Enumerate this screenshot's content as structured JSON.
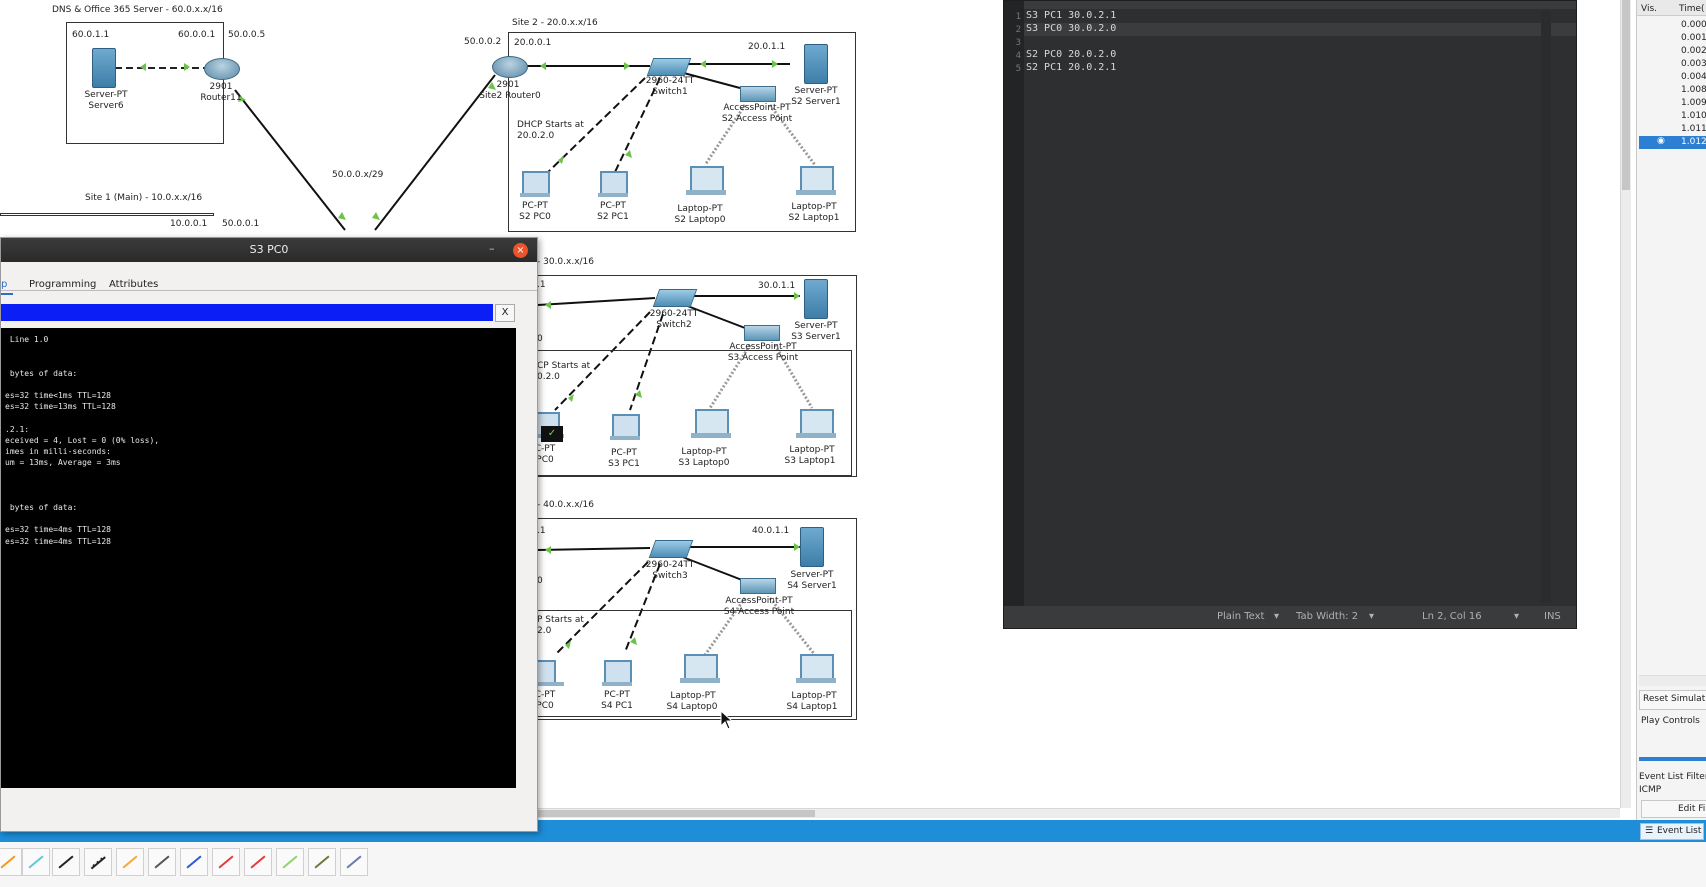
{
  "topology": {
    "dns_box": {
      "title": "DNS & Office 365 Server - 60.0.x.x/16",
      "ip_left": "60.0.1.1",
      "ip_right": "60.0.0.1",
      "ip_link": "50.0.0.5",
      "server_type": "Server-PT",
      "server_name": "Server6",
      "router_model": "2901",
      "router_name": "Router11"
    },
    "site1": {
      "title": "Site 1 (Main) - 10.0.x.x/16",
      "ip_a": "10.0.0.1",
      "ip_b": "50.0.0.1",
      "wan": "50.0.0.x/29"
    },
    "site2": {
      "title": "Site 2 - 20.0.x.x/16",
      "router_ip_wan": "50.0.0.2",
      "router_ip_lan": "20.0.0.1",
      "router_model": "2901",
      "router_name": "Site2 Router0",
      "switch_model": "2960-24TT",
      "switch_name": "Switch1",
      "server_ip": "20.0.1.1",
      "server_type": "Server-PT",
      "server_name": "S2 Server1",
      "ap_type": "AccessPoint-PT",
      "ap_name": "S2 Access Point",
      "dhcp_note_1": "DHCP Starts at",
      "dhcp_note_2": "20.0.2.0",
      "pc_type": "PC-PT",
      "pc0": "S2 PC0",
      "pc1": "S2 PC1",
      "laptop_type": "Laptop-PT",
      "laptop0": "S2 Laptop0",
      "laptop1": "S2 Laptop1"
    },
    "site3": {
      "title": "- 30.0.x.x/16",
      "router_ip": ".1",
      "router_ip2": "0",
      "switch_model": "2960-24TT",
      "switch_name": "Switch2",
      "server_ip": "30.0.1.1",
      "server_type": "Server-PT",
      "server_name": "S3 Server1",
      "ap_type": "AccessPoint-PT",
      "ap_name": "S3 Access Point",
      "dhcp_note_1": "CP Starts at",
      "dhcp_note_2": "0.2.0",
      "pc0_type": "C-PT",
      "pc0": "PC0",
      "pc_type": "PC-PT",
      "pc1": "S3 PC1",
      "laptop_type": "Laptop-PT",
      "laptop0": "S3 Laptop0",
      "laptop1": "S3 Laptop1"
    },
    "site4": {
      "title": "- 40.0.x.x/16",
      "router_ip": ".1",
      "router_ip2": "0",
      "switch_model": "2960-24TT",
      "switch_name": "Switch3",
      "server_ip": "40.0.1.1",
      "server_type": "Server-PT",
      "server_name": "S4 Server1",
      "ap_type": "AccessPoint-PT",
      "ap_name": "S4 Access Point",
      "dhcp_note_1": "P Starts at",
      "dhcp_note_2": "2.0",
      "pc0_type": "C-PT",
      "pc0": "PC0",
      "pc_type": "PC-PT",
      "pc1": "S4 PC1",
      "laptop_type": "Laptop-PT",
      "laptop0": "S4 Laptop0",
      "laptop1": "S4 Laptop1"
    }
  },
  "terminal": {
    "title": "S3 PC0",
    "tabs": [
      "p",
      "Programming",
      "Attributes"
    ],
    "close_x": "X",
    "minimize": "–",
    "lines": [
      " Line 1.0",
      "",
      "",
      " bytes of data:",
      "",
      "es=32 time<1ms TTL=128",
      "es=32 time=13ms TTL=128",
      "",
      ".2.1:",
      "eceived = 4, Lost = 0 (0% loss),",
      "imes in milli-seconds:",
      "um = 13ms, Average = 3ms",
      "",
      "",
      "",
      " bytes of data:",
      "",
      "es=32 time=4ms TTL=128",
      "es=32 time=4ms TTL=128"
    ]
  },
  "editor": {
    "lines": [
      {
        "num": "1",
        "text": "S3 PC1 30.0.2.1"
      },
      {
        "num": "2",
        "text": "S3 PC0 30.0.2.0"
      },
      {
        "num": "3",
        "text": ""
      },
      {
        "num": "4",
        "text": "S2 PC0 20.0.2.0"
      },
      {
        "num": "5",
        "text": "S2 PC1 20.0.2.1"
      }
    ],
    "status": {
      "mode": "Plain Text",
      "tab_width": "Tab Width: 2",
      "position": "Ln 2, Col 16",
      "ins": "INS"
    }
  },
  "sim_panel": {
    "col_vis": "Vis.",
    "col_time": "Time(",
    "times": [
      "0.000",
      "0.001",
      "0.002",
      "0.003",
      "0.004",
      "1.008",
      "1.009",
      "1.010",
      "1.011",
      "1.012"
    ],
    "reset": "Reset Simulati",
    "play_controls": "Play Controls",
    "event_filter": "Event List Filter",
    "icmp": "ICMP",
    "edit_filter": "Edit Fil",
    "event_list": "Event List"
  },
  "colors": {
    "accent_blue": "#1e8ed8",
    "console_bg": "#000000",
    "editor_bg": "#2d2f31",
    "terminal_bar": "#0a1ef5"
  }
}
